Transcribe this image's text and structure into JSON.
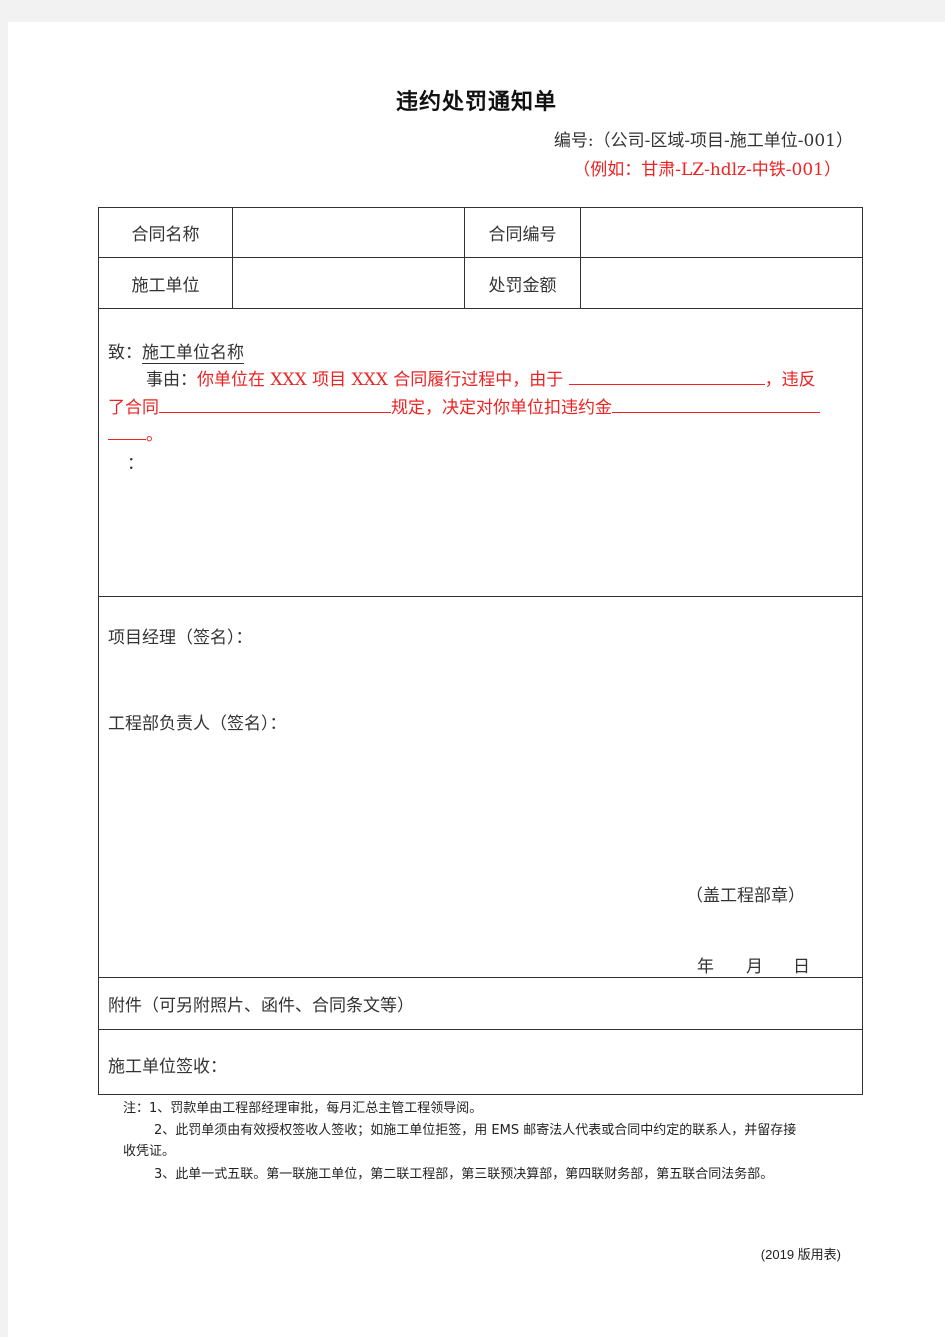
{
  "document": {
    "title": "违约处罚通知单",
    "code_line": "编号:（公司-区域-项目-施工单位-001）",
    "example_line": "（例如：甘肃-LZ-hdlz-中铁-001）"
  },
  "header_table": {
    "rows": [
      {
        "label1": "合同名称",
        "value1": "",
        "label2": "合同编号",
        "value2": ""
      },
      {
        "label1": "施工单位",
        "value1": "",
        "label2": "处罚金额",
        "value2": ""
      }
    ]
  },
  "notice": {
    "to_label": "致：",
    "to_name": "施工单位名称",
    "reason_label": "事由：",
    "reason_part1": "你单位在 XXX 项目 XXX 合同履行过程中，由于",
    "reason_part2": "，违反",
    "reason_part3": "了合同",
    "reason_part4": "规定，决定对你单位扣违约金",
    "reason_end": "。",
    "colon_line": "："
  },
  "signatures": {
    "project_manager": "项目经理（签名）：",
    "engineering_head": "工程部负责人（签名）：",
    "seal": "（盖工程部章）",
    "year": "年",
    "month": "月",
    "day": "日"
  },
  "attachment": {
    "label": "附件（可另附照片、函件、合同条文等）"
  },
  "receipt": {
    "label": "施工单位签收："
  },
  "notes": {
    "note1": "注：1、罚款单由工程部经理审批，每月汇总主管工程领导阅。",
    "note2a": "2、此罚单须由有效授权签收人签收；如施工单位拒签，用 EMS 邮寄法人代表或合同中约定的联系人，并留存接",
    "note2b": "收凭证。",
    "note3": "3、此单一式五联。第一联施工单位，第二联工程部，第三联预决算部，第四联财务部，第五联合同法务部。"
  },
  "version": "(2019 版用表)",
  "colors": {
    "accent_red": "#ee2222",
    "text": "#333333",
    "background": "#f2f2f2"
  }
}
